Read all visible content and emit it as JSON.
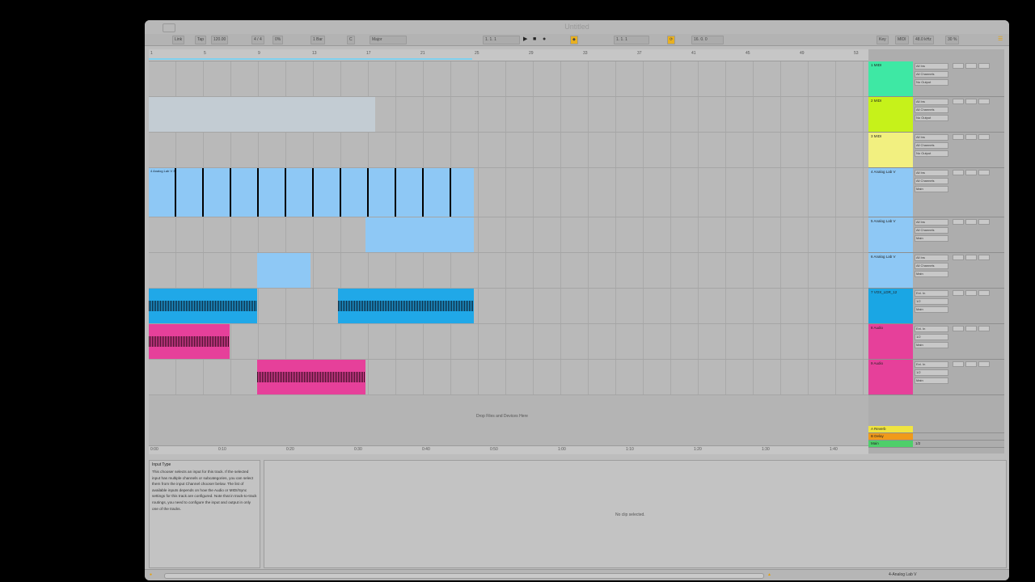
{
  "app": {
    "title": "Untitled"
  },
  "toolbar": {
    "link": "Link",
    "tap": "Tap",
    "tempo": "120.00",
    "signature": "4 / 4",
    "swing": "0%",
    "bar": "1 Bar",
    "key": "C",
    "scale": "Major",
    "position": "1. 1. 1",
    "loop_start": "1. 1. 1",
    "loop_len": "16. 0. 0",
    "key_btn": "Key",
    "midi_btn": "MIDI",
    "sample_rate": "48.0 kHz",
    "cpu": "30 %"
  },
  "ruler": {
    "bars": [
      "1",
      "5",
      "9",
      "13",
      "17",
      "21",
      "25",
      "29",
      "33",
      "37",
      "41",
      "45",
      "49",
      "53"
    ]
  },
  "timeline": {
    "times": [
      "0:00",
      "0:10",
      "0:20",
      "0:30",
      "0:40",
      "0:50",
      "1:00",
      "1:10",
      "1:20",
      "1:30",
      "1:40"
    ]
  },
  "arranger": {
    "drop_text": "Drop Files and Devices Here",
    "clips": [
      {
        "label": "4 Analog Lab V 3"
      }
    ]
  },
  "tracks": [
    {
      "name": "1 MIDI",
      "color": "#3ee8a4",
      "input": "All Ins",
      "channel": "All Channels",
      "output": "No Output"
    },
    {
      "name": "2 MIDI",
      "color": "#c6f21a",
      "input": "All Ins",
      "channel": "All Channels",
      "output": "No Output"
    },
    {
      "name": "3 MIDI",
      "color": "#f2f080",
      "input": "All Ins",
      "channel": "All Channels",
      "output": "No Output"
    },
    {
      "name": "4 Analog Lab V",
      "color": "#8ec8f5",
      "input": "All Ins",
      "channel": "All Channels",
      "output": "Main"
    },
    {
      "name": "5 Analog Lab V",
      "color": "#8ec8f5",
      "input": "All Ins",
      "channel": "All Channels",
      "output": "Main"
    },
    {
      "name": "6 Analog Lab V",
      "color": "#8ec8f5",
      "input": "All Ins",
      "channel": "All Channels",
      "output": "Main"
    },
    {
      "name": "7 VOX_LDR_12",
      "color": "#1aa6e4",
      "input": "Ext. In",
      "channel": "1/2",
      "output": "Main"
    },
    {
      "name": "8 Audio",
      "color": "#e6409a",
      "input": "Ext. In",
      "channel": "1/2",
      "output": "Main"
    },
    {
      "name": "9 Audio",
      "color": "#e6409a",
      "input": "Ext. In",
      "channel": "1/2",
      "output": "Main"
    }
  ],
  "returns": [
    {
      "name": "A Reverb",
      "color": "#f0e440"
    },
    {
      "name": "B Delay",
      "color": "#f09a1a"
    },
    {
      "name": "Main",
      "color": "#4ecf6a",
      "value": "1/2"
    }
  ],
  "info": {
    "title": "Input Type",
    "body": "This chooser selects an input for this track. If the selected input has multiple channels or subcategories, you can select them from the input Channel chooser below. The list of available inputs depends on how the Audio or MIDI/Sync settings for this track are configured. Note that in track-to-track routings, you need to configure the input and output in only one of the tracks."
  },
  "detail": {
    "empty_text": "No clip selected."
  },
  "status": {
    "track_name": "4-Analog Lab V"
  }
}
